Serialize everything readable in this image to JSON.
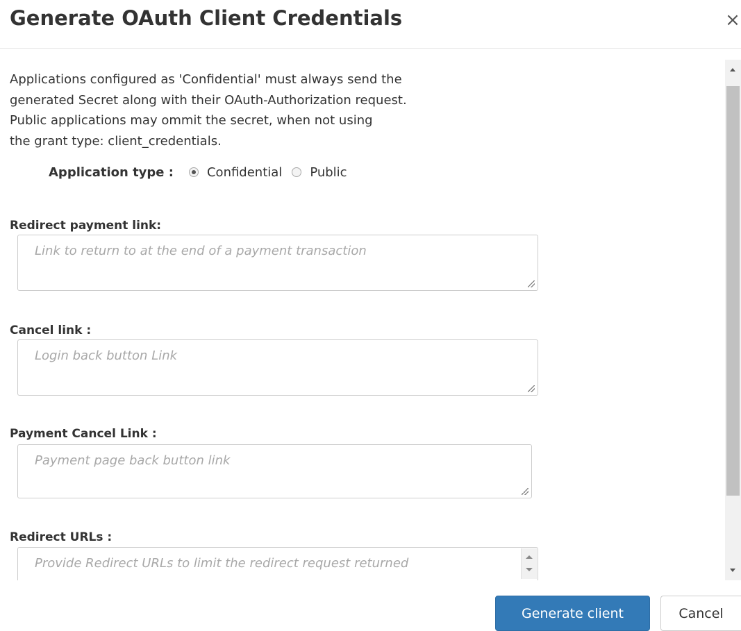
{
  "dialog": {
    "title": "Generate OAuth Client Credentials",
    "close_glyph": "×"
  },
  "intro": {
    "lines": [
      "Applications configured as 'Confidential' must always send the",
      "generated Secret along with their OAuth-Authorization request.",
      "Public applications may ommit the secret, when not using",
      "the grant type: client_credentials."
    ]
  },
  "application_type": {
    "label": "Application type :",
    "options": [
      {
        "label": "Confidential",
        "selected": true
      },
      {
        "label": "Public",
        "selected": false
      }
    ]
  },
  "fields": {
    "redirect_payment_link": {
      "label": "Redirect payment link:",
      "value": "",
      "placeholder": "Link to return to at the end of a payment transaction"
    },
    "cancel_link": {
      "label": "Cancel link :",
      "value": "",
      "placeholder": "Login back button Link"
    },
    "payment_cancel_link": {
      "label": "Payment Cancel Link :",
      "value": "",
      "placeholder": "Payment page back button link"
    },
    "redirect_urls": {
      "label": "Redirect URLs :",
      "value": "",
      "placeholder": "Provide Redirect URLs to limit the redirect request returned"
    }
  },
  "footer": {
    "generate_label": "Generate client",
    "cancel_label": "Cancel"
  },
  "colors": {
    "primary": "#337ab7",
    "placeholder": "#a8a8a8",
    "text": "#333333"
  },
  "icons": {
    "close": "close-icon",
    "resize": "resize-grip-icon",
    "scroll_up": "scroll-up-arrow-icon",
    "scroll_down": "scroll-down-arrow-icon"
  }
}
